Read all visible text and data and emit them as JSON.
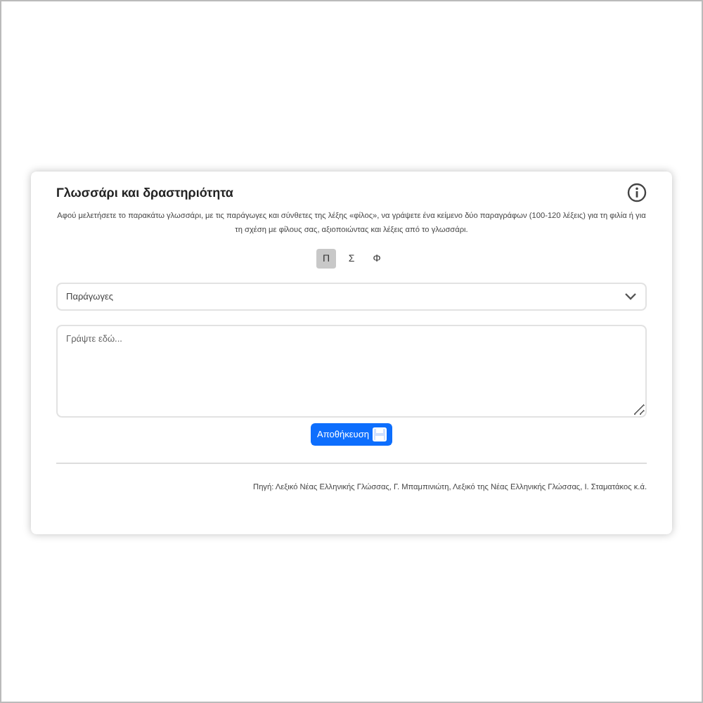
{
  "card": {
    "title": "Γλωσσάρι και δραστηριότητα",
    "instructions": "Αφού μελετήσετε το παρακάτω γλωσσάρι, με τις παράγωγες και σύνθετες της λέξης «φίλος», να γράψετε ένα κείμενο δύο παραγράφων (100-120 λέξεις) για τη φιλία ή για τη σχέση με φίλους σας, αξιοποιώντας και λέξεις από το γλωσσάρι.",
    "letters": [
      {
        "label": "Π",
        "selected": true
      },
      {
        "label": "Σ",
        "selected": false
      },
      {
        "label": "Φ",
        "selected": false
      }
    ],
    "select": {
      "value": "Παράγωγες"
    },
    "textarea": {
      "placeholder": "Γράψτε εδώ..."
    },
    "save_button": "Αποθήκευση",
    "source": "Πηγή: Λεξικό Νέας Ελληνικής Γλώσσας, Γ. Μπαμπινιώτη, Λεξικό της Νέας Ελληνικής Γλώσσας, Ι. Σταματάκος κ.ά."
  }
}
